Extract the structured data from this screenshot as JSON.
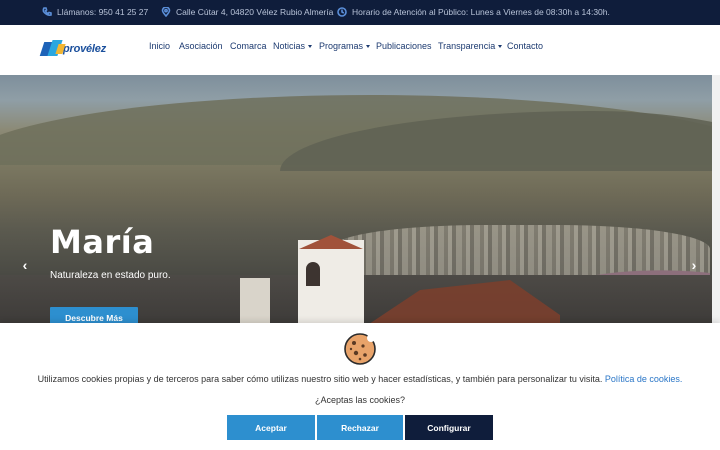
{
  "topbar": {
    "phone": "Llámanos: 950 41 25 27",
    "address": "Calle Cútar 4, 04820 Vélez Rubio Almería",
    "hours": "Horario de Atención al Público: Lunes a Viernes de 08:30h a 14:30h.",
    "icons": [
      "phone-icon",
      "map-pin-icon",
      "clock-icon"
    ],
    "icon_color": "#5b8fd9",
    "background": "#0f1d3b"
  },
  "logo": {
    "text": "Aprovélez"
  },
  "nav": {
    "items": [
      {
        "label": "Inicio",
        "dropdown": false
      },
      {
        "label": "Asociación",
        "dropdown": false
      },
      {
        "label": "Comarca",
        "dropdown": false
      },
      {
        "label": "Noticias",
        "dropdown": true
      },
      {
        "label": "Programas",
        "dropdown": true
      },
      {
        "label": "Publicaciones",
        "dropdown": false
      },
      {
        "label": "Transparencia",
        "dropdown": true
      },
      {
        "label": "Contacto",
        "dropdown": false
      }
    ]
  },
  "hero": {
    "title": "María",
    "subtitle": "Naturaleza en estado puro.",
    "button_label": "Descubre Más",
    "prev_icon": "‹",
    "next_icon": "›"
  },
  "cookie": {
    "text": "Utilizamos cookies propias y de terceros para saber cómo utilizas nuestro sitio web y hacer estadísticas, y también para personalizar tu visita.",
    "policy_link": "Política de cookies.",
    "question": "¿Aceptas las cookies?",
    "accept_label": "Aceptar",
    "reject_label": "Rechazar",
    "config_label": "Configurar",
    "accent": "#2d8fcf",
    "dark": "#0f1d3b"
  }
}
